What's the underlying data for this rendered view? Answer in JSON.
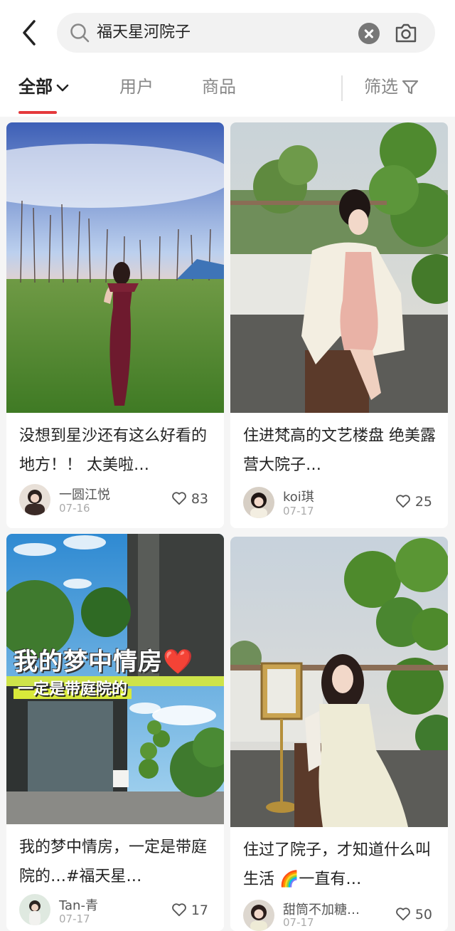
{
  "search": {
    "query": "福天星河院子"
  },
  "tabs": {
    "all": "全部",
    "users": "用户",
    "goods": "商品",
    "filter": "筛选"
  },
  "icons": [
    "back-arrow-icon",
    "search-icon",
    "clear-icon",
    "camera-icon",
    "chevron-down-icon",
    "filter-icon",
    "heart-icon"
  ],
  "colors": {
    "accent": "#e4393c"
  },
  "posts": [
    {
      "title": "没想到星沙还有这么好看的地方！！ 太美啦…",
      "author": "一圆江悦",
      "date": "07-16",
      "likes": "83"
    },
    {
      "title": "住进梵高的文艺楼盘  绝美露营大院子…",
      "author": "koi琪",
      "date": "07-17",
      "likes": "25"
    },
    {
      "title": "我的梦中情房，一定是带庭院的…#福天星…",
      "author": "Tan-青",
      "date": "07-17",
      "likes": "17",
      "overlay_title": "我的梦中情房",
      "overlay_subtitle": "一定是带庭院的",
      "overlay_emoji": "❤️"
    },
    {
      "title": "住过了院子，才知道什么叫生活 🌈一直有…",
      "author": "甜筒不加糖…",
      "date": "07-17",
      "likes": "50"
    }
  ]
}
